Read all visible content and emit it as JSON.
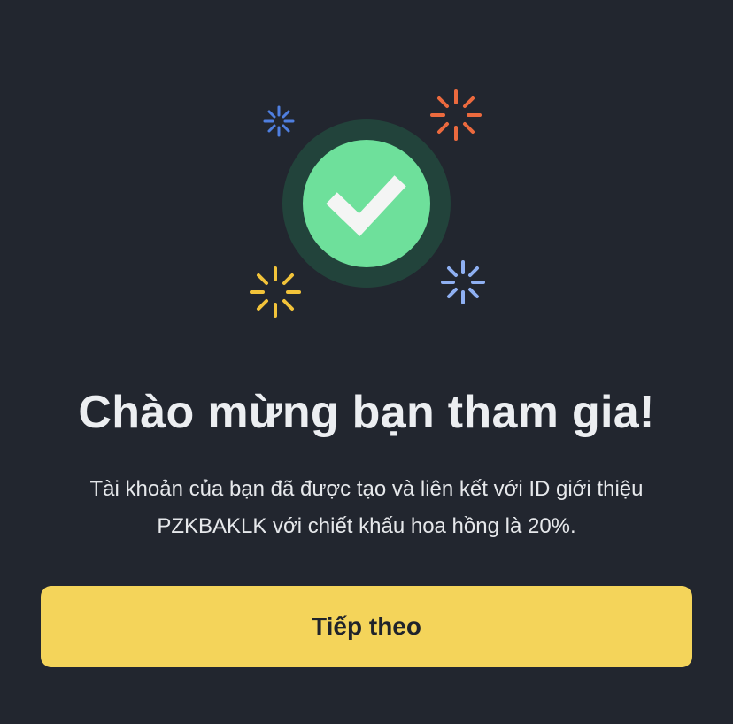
{
  "dialog": {
    "title": "Chào mừng bạn tham gia!",
    "message": "Tài khoản của bạn đã được tạo và liên kết với ID giới thiệu PZKBAKLK với chiết khấu hoa hồng là 20%.",
    "continue_label": "Tiếp theo"
  },
  "icons": {
    "success": "check-circle-icon",
    "sparkles": [
      "sparkle-icon-blue-small",
      "sparkle-icon-orange",
      "sparkle-icon-yellow",
      "sparkle-icon-blue"
    ]
  },
  "colors": {
    "background": "#22262f",
    "check_ring": "#22433b",
    "check_fill": "#6ee09b",
    "check_mark": "#f4f5f4",
    "button": "#f4d45a",
    "sparkle_blue": "#4f7fe0",
    "sparkle_orange": "#ec6a3e",
    "sparkle_yellow": "#f2c33a",
    "sparkle_light_blue": "#8fb0f2"
  }
}
